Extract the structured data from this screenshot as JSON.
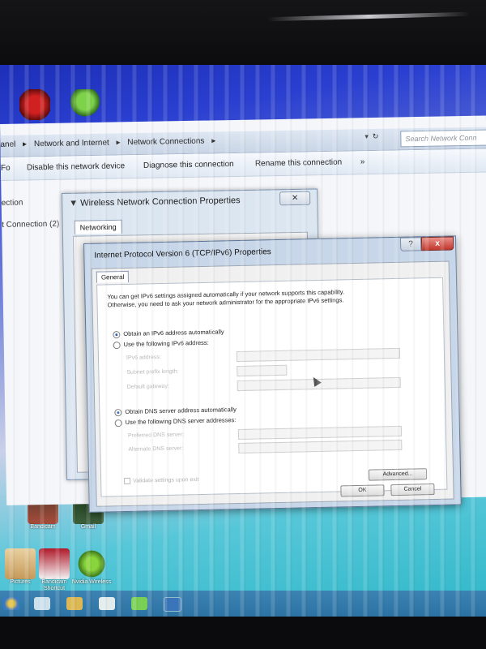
{
  "explorer": {
    "breadcrumb": [
      "anel",
      "Network and Internet",
      "Network Connections"
    ],
    "search_placeholder": "Search Network Conn",
    "commands": {
      "fo": "Fo",
      "disable": "Disable this network device",
      "diagnose": "Diagnose this connection",
      "rename": "Rename this connection",
      "more": "»"
    },
    "left_items": [
      "ection",
      "t Connection (2) 1"
    ]
  },
  "wifi_dialog": {
    "title": "Wireless Network Connection Properties",
    "tab": "Networking"
  },
  "ipv6_dialog": {
    "title": "Internet Protocol Version 6 (TCP/IPv6) Properties",
    "help": "?",
    "close": "x",
    "tab": "General",
    "info_line1": "You can get IPv6 settings assigned automatically if your network supports this capability.",
    "info_line2": "Otherwise, you need to ask your network administrator for the appropriate IPv6 settings.",
    "radio_auto_ip": "Obtain an IPv6 address automatically",
    "radio_manual_ip": "Use the following IPv6 address:",
    "field_ipv6": "IPv6 address:",
    "field_prefix": "Subnet prefix length:",
    "field_gateway": "Default gateway:",
    "radio_auto_dns": "Obtain DNS server address automatically",
    "radio_manual_dns": "Use the following DNS server addresses:",
    "field_pref_dns": "Preferred DNS server:",
    "field_alt_dns": "Alternate DNS server:",
    "validate": "Validate settings upon exit",
    "advanced": "Advanced...",
    "ok": "OK",
    "cancel": "Cancel"
  },
  "desktop_icons": [
    "Bandicam",
    "Gmail",
    "Pictures",
    "Bandicam Shortcut",
    "Nvidia Wireless"
  ],
  "colors": {
    "titlebar": "#c7d6e8",
    "close_red": "#c2352b",
    "desktop_blue": "#2a3fd0"
  }
}
